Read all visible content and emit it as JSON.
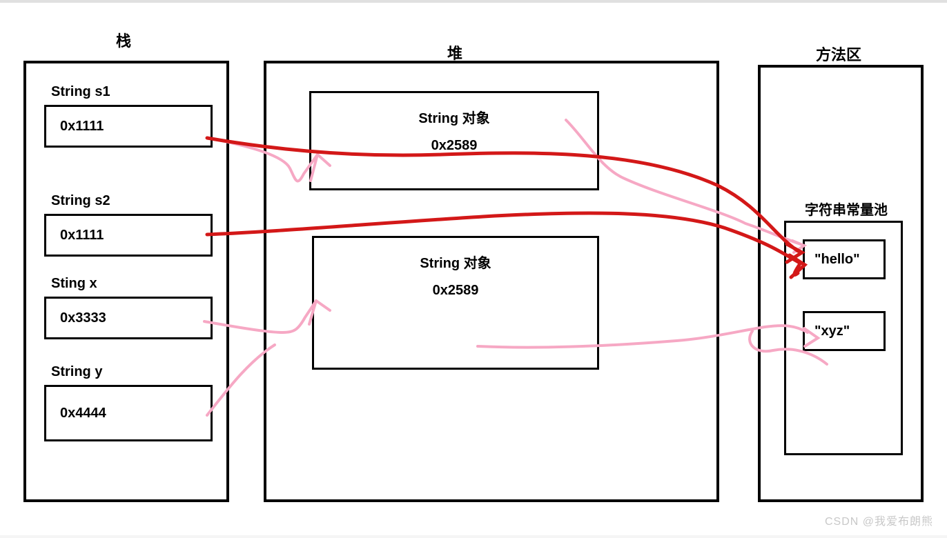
{
  "titles": {
    "stack": "栈",
    "heap": "堆",
    "method_area": "方法区"
  },
  "stack": {
    "s1": {
      "label": "String s1",
      "value": "0x1111"
    },
    "s2": {
      "label": "String s2",
      "value": "0x1111"
    },
    "x": {
      "label": "Sting x",
      "value": "0x3333"
    },
    "y": {
      "label": "String y",
      "value": "0x4444"
    }
  },
  "heap": {
    "obj1": {
      "title": "String 对象",
      "addr": "0x2589"
    },
    "obj2": {
      "title": "String 对象",
      "addr": "0x2589"
    }
  },
  "method_area": {
    "pool_title": "字符串常量池",
    "pool": {
      "hello": "\"hello\"",
      "xyz": "\"xyz\""
    }
  },
  "watermark": "CSDN @我爱布朗熊",
  "arrow_colors": {
    "red": "#d31818",
    "pink": "#f6a8c4"
  }
}
